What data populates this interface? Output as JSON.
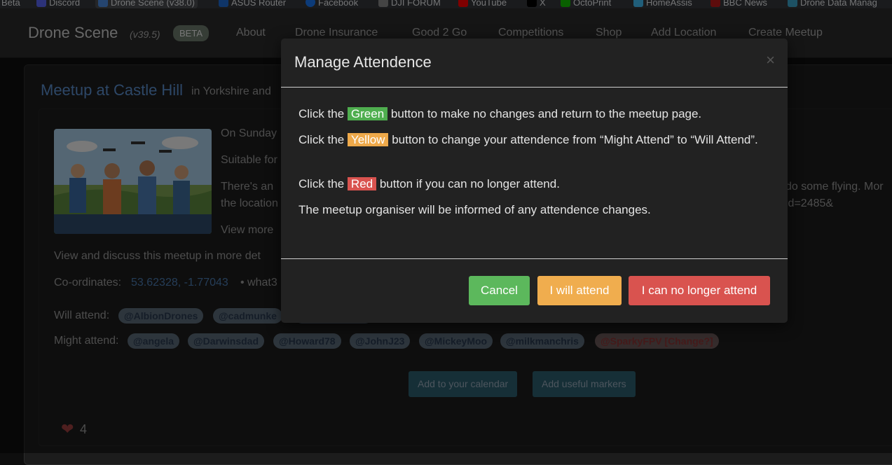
{
  "bookmarks": [
    {
      "label": "Beta",
      "color": "#35363a"
    },
    {
      "label": "Discord",
      "color": "#5865f2"
    },
    {
      "label": "Drone Scene (v38.0)",
      "color": "#4a8be0",
      "active": true
    },
    {
      "label": "ASUS Router",
      "color": "#1e6ad0"
    },
    {
      "label": "Facebook",
      "color": "#1877f2"
    },
    {
      "label": "DJI FORUM",
      "color": "#888888"
    },
    {
      "label": "YouTube",
      "color": "#ff0000"
    },
    {
      "label": "X",
      "color": "#000000"
    },
    {
      "label": "OctoPrint",
      "color": "#13c100"
    },
    {
      "label": "HomeAssis",
      "color": "#41bdf5"
    },
    {
      "label": "BBC News",
      "color": "#bb1919"
    },
    {
      "label": "Drone Data Manag",
      "color": "#3aa3c8"
    }
  ],
  "navbar": {
    "brand": "Drone Scene",
    "version": "(v39.5)",
    "beta": "BETA",
    "links": [
      "About",
      "Drone Insurance",
      "Good 2 Go",
      "Competitions",
      "Shop",
      "Add Location",
      "Create Meetup"
    ]
  },
  "meetup": {
    "title": "Meetup at Castle Hill",
    "subtitle": "in Yorkshire and",
    "line1": "On Sunday",
    "line2": "Suitable for",
    "line3a": "There's an",
    "line3b": "the location",
    "line3_right": "do some flying. Mor",
    "line3_right2": "id=2485&",
    "view_more": "View more",
    "discuss": "View and discuss this meetup in more det",
    "coords_label": "Co-ordinates:",
    "coords_value": "53.62328, -1.77043",
    "coords_rest": "• what3",
    "will_attend_label": "Will attend:",
    "will_attend": [
      "@AlbionDrones",
      "@cadmunke"
    ],
    "might_attend_label": "Might attend:",
    "might_attend": [
      "@angela",
      "@Darwinsdad",
      "@Howard78",
      "@JohnJ23",
      "@MickeyMoo",
      "@milkmanchris"
    ],
    "might_attend_self": "@SparkyFPV [Change?]",
    "calendar_button": "Add to your calendar",
    "markers_button": "Add useful markers",
    "likes": "4"
  },
  "modal": {
    "title": "Manage Attendence",
    "close": "×",
    "p1_pre": "Click the",
    "p1_hl": "Green",
    "p1_post": "button to make no changes and return to the meetup page.",
    "p2_pre": "Click the",
    "p2_hl": "Yellow",
    "p2_post": "button to change your attendence from “Might Attend” to “Will Attend”.",
    "p3_pre": "Click the",
    "p3_hl": "Red",
    "p3_post": "button if you can no longer attend.",
    "p4": "The meetup organiser will be informed of any attendence changes.",
    "cancel": "Cancel",
    "will_attend": "I will attend",
    "no_longer": "I can no longer attend"
  }
}
